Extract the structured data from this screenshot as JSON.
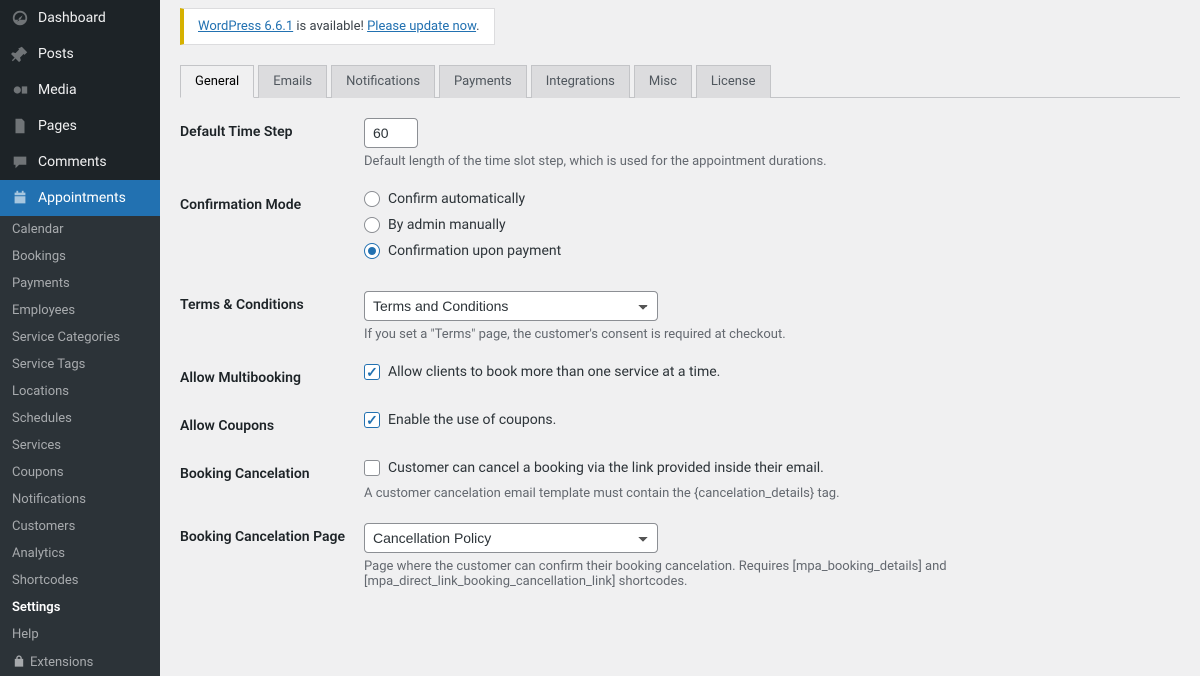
{
  "sidebar": {
    "menu": [
      {
        "icon": "dashboard",
        "label": "Dashboard"
      },
      {
        "icon": "pin",
        "label": "Posts"
      },
      {
        "icon": "media",
        "label": "Media"
      },
      {
        "icon": "page",
        "label": "Pages"
      },
      {
        "icon": "comment",
        "label": "Comments"
      },
      {
        "icon": "calendar",
        "label": "Appointments",
        "active": true
      }
    ],
    "submenu": [
      "Calendar",
      "Bookings",
      "Payments",
      "Employees",
      "Service Categories",
      "Service Tags",
      "Locations",
      "Schedules",
      "Services",
      "Coupons",
      "Notifications",
      "Customers",
      "Analytics",
      "Shortcodes",
      "Settings",
      "Help",
      "Extensions"
    ],
    "submenu_current": "Settings",
    "extensions_label": "Extensions"
  },
  "notice": {
    "prefix": "WordPress 6.6.1",
    "middle": " is available! ",
    "link": "Please update now",
    "suffix": "."
  },
  "tabs": [
    "General",
    "Emails",
    "Notifications",
    "Payments",
    "Integrations",
    "Misc",
    "License"
  ],
  "tabs_active": "General",
  "form": {
    "time_step": {
      "label": "Default Time Step",
      "value": "60",
      "desc": "Default length of the time slot step, which is used for the appointment durations."
    },
    "confirmation": {
      "label": "Confirmation Mode",
      "options": [
        "Confirm automatically",
        "By admin manually",
        "Confirmation upon payment"
      ],
      "selected": "Confirmation upon payment"
    },
    "terms": {
      "label": "Terms & Conditions",
      "value": "Terms and Conditions",
      "desc": "If you set a \"Terms\" page, the customer's consent is required at checkout."
    },
    "multibooking": {
      "label": "Allow Multibooking",
      "checkbox_label": "Allow clients to book more than one service at a time.",
      "checked": true
    },
    "coupons": {
      "label": "Allow Coupons",
      "checkbox_label": "Enable the use of coupons.",
      "checked": true
    },
    "cancelation": {
      "label": "Booking Cancelation",
      "checkbox_label": "Customer can cancel a booking via the link provided inside their email.",
      "checked": false,
      "desc": "A customer cancelation email template must contain the {cancelation_details} tag."
    },
    "cancelation_page": {
      "label": "Booking Cancelation Page",
      "value": "Cancellation Policy",
      "desc": "Page where the customer can confirm their booking cancelation. Requires [mpa_booking_details] and [mpa_direct_link_booking_cancellation_link] shortcodes."
    }
  }
}
